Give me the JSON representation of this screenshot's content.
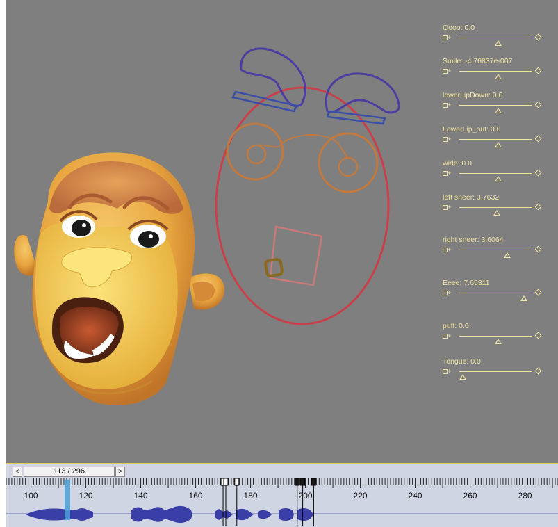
{
  "sliders": [
    {
      "label": "Oooo: 0.0",
      "value": 0.0
    },
    {
      "label": "Smile: -4.76837e-007",
      "value": 0.0
    },
    {
      "label": "lowerLipDown: 0.0",
      "value": 0.0
    },
    {
      "label": "LowerLip_out: 0.0",
      "value": 0.0
    },
    {
      "label": "wide: 0.0",
      "value": 0.0
    },
    {
      "label": "left sneer: 3.7632",
      "value": 0.0
    },
    {
      "label": "right sneer: 3.6064",
      "value": 0.12
    },
    {
      "label": "Eeee: 7.65311",
      "value": 0.4
    },
    {
      "label": "puff: 0.0",
      "value": 0.0
    },
    {
      "label": "Tongue: 0.0",
      "value": -0.5
    }
  ],
  "slider_min_glyph": "+",
  "timeline": {
    "prev_label": "<",
    "next_label": ">",
    "frame_counter": "113 / 296",
    "current_frame": 113,
    "total_frames": 296,
    "range_start": 91,
    "range_end": 296,
    "tick_labels": [
      "100",
      "120",
      "140",
      "160",
      "180",
      "200",
      "220",
      "240",
      "260",
      "280"
    ]
  },
  "colors": {
    "viewport_bg": "#7f7f7f",
    "slider_text": "#f1e3a0",
    "face_outline": "#c8404a",
    "brow_control": "#4b3ea0",
    "eye_control": "#c07a40",
    "mouth_control": "#c87a78",
    "jaw_control": "#8a6a20",
    "waveform": "#3a3fa8",
    "playhead": "#4aa0d8",
    "skin": "#e8a640"
  }
}
